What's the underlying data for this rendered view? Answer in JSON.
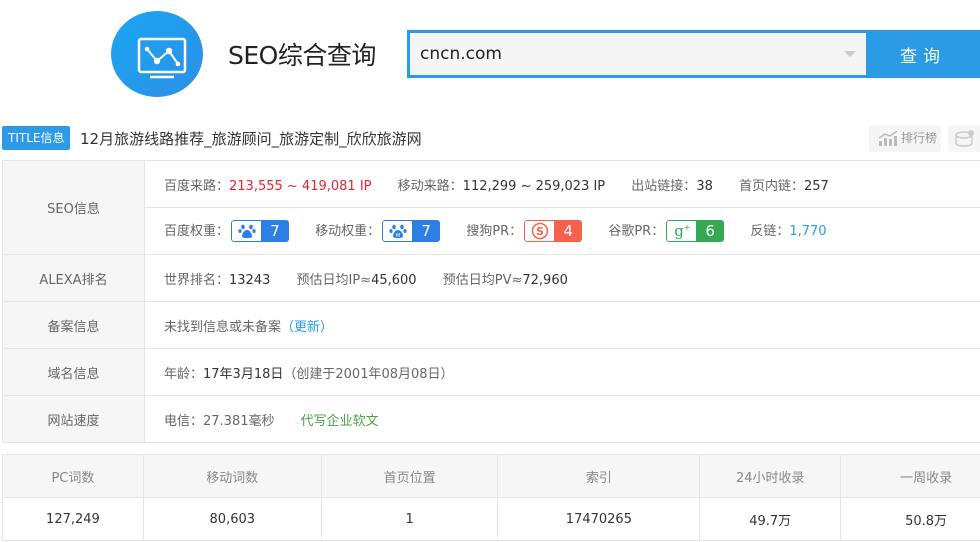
{
  "header": {
    "logo_icon": "monitor-chart-icon",
    "title": "SEO综合查询",
    "search": {
      "value": "cncn.com",
      "placeholder": "",
      "button_label": "查询"
    }
  },
  "title_row": {
    "badge": "TITLE信息",
    "text": "12月旅游线路推荐_旅游顾问_旅游定制_欣欣旅游网",
    "rank_button": "排行榜"
  },
  "seo": {
    "label": "SEO信息",
    "baidu_traffic_label": "百度来路：",
    "baidu_traffic_value": "213,555 ~ 419,081",
    "baidu_traffic_unit": " IP",
    "mobile_traffic_label": "移动来路：",
    "mobile_traffic_value": "112,299 ~ 259,023 IP",
    "outbound_label": "出站链接：",
    "outbound_value": "38",
    "inbound_label": "首页内链：",
    "inbound_value": "257",
    "baidu_weight_label": "百度权重：",
    "baidu_weight_value": "7",
    "mobile_weight_label": "移动权重：",
    "mobile_weight_value": "7",
    "sogou_pr_label": "搜狗PR：",
    "sogou_pr_value": "4",
    "google_pr_label": "谷歌PR：",
    "google_pr_value": "6",
    "backlinks_label": "反链：",
    "backlinks_value": "1,770"
  },
  "alexa": {
    "label": "ALEXA排名",
    "world_rank_label": "世界排名：",
    "world_rank_value": "13243",
    "daily_ip_label": "预估日均IP≈",
    "daily_ip_value": "45,600",
    "daily_pv_label": "预估日均PV≈",
    "daily_pv_value": "72,960"
  },
  "icp": {
    "label": "备案信息",
    "text": "未找到信息或未备案",
    "update_link": "（更新）"
  },
  "domain": {
    "label": "域名信息",
    "age_label": "年龄：",
    "age_value": "17年3月18日",
    "created": "（创建于2001年08月08日）"
  },
  "speed": {
    "label": "网站速度",
    "telecom": "电信：27.381毫秒",
    "ad_link": "代写企业软文"
  },
  "stats": {
    "headers": [
      "PC词数",
      "移动词数",
      "首页位置",
      "索引",
      "24小时收录",
      "一周收录"
    ],
    "values": [
      "127,249",
      "80,603",
      "1",
      "17470265",
      "49.7万",
      "50.8万"
    ]
  },
  "colors": {
    "accent": "#2b9be6",
    "red": "#e4262f",
    "baidu": "#2b7fe6",
    "sogou": "#f5614c",
    "google": "#34a853",
    "ad_green": "#4aa548"
  }
}
